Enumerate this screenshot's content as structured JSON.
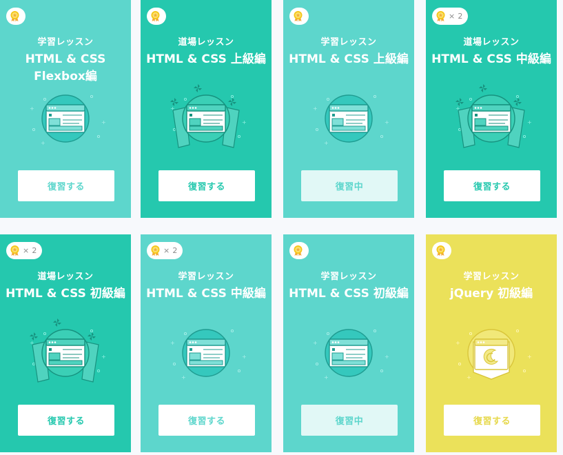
{
  "colors": {
    "card_light": "#5dd6cc",
    "card_dark": "#25c8ae",
    "card_yellow": "#ebe15a",
    "button_text_light": "#5dd6cc",
    "button_text_dark": "#25c8ae",
    "button_text_yellow": "#e6d84a",
    "medal_gold": "#f5c518"
  },
  "cards": [
    {
      "type": "学習レッスン",
      "title_line1": "HTML & CSS",
      "title_line2": "Flexbox編",
      "button": "復習する",
      "badge_count": "",
      "badge_icon": "medal-icon",
      "theme": "light",
      "illustration": "web-page",
      "button_state": "review"
    },
    {
      "type": "道場レッスン",
      "title_line1": "HTML & CSS 上級編",
      "title_line2": "",
      "button": "復習する",
      "badge_count": "",
      "badge_icon": "medal-icon",
      "theme": "dark",
      "illustration": "dojo-scroll",
      "button_state": "review"
    },
    {
      "type": "学習レッスン",
      "title_line1": "HTML & CSS 上級編",
      "title_line2": "",
      "button": "復習中",
      "badge_count": "",
      "badge_icon": "medal-icon",
      "theme": "light",
      "illustration": "web-page",
      "button_state": "in-progress"
    },
    {
      "type": "道場レッスン",
      "title_line1": "HTML & CSS 中級編",
      "title_line2": "",
      "button": "復習する",
      "badge_count": "× 2",
      "badge_icon": "medal-icon",
      "theme": "dark",
      "illustration": "dojo-scroll",
      "button_state": "review"
    },
    {
      "type": "道場レッスン",
      "title_line1": "HTML & CSS 初級編",
      "title_line2": "",
      "button": "復習する",
      "badge_count": "× 2",
      "badge_icon": "medal-icon",
      "theme": "dark",
      "illustration": "dojo-scroll",
      "button_state": "review"
    },
    {
      "type": "学習レッスン",
      "title_line1": "HTML & CSS 中級編",
      "title_line2": "",
      "button": "復習する",
      "badge_count": "× 2",
      "badge_icon": "medal-icon",
      "theme": "light",
      "illustration": "web-page",
      "button_state": "review"
    },
    {
      "type": "学習レッスン",
      "title_line1": "HTML & CSS 初級編",
      "title_line2": "",
      "button": "復習中",
      "badge_count": "",
      "badge_icon": "medal-icon",
      "theme": "light",
      "illustration": "web-page",
      "button_state": "in-progress"
    },
    {
      "type": "学習レッスン",
      "title_line1": "jQuery 初級編",
      "title_line2": "",
      "button": "復習する",
      "badge_count": "",
      "badge_icon": "medal-icon",
      "theme": "yellow",
      "illustration": "jquery-page",
      "button_state": "review"
    }
  ]
}
